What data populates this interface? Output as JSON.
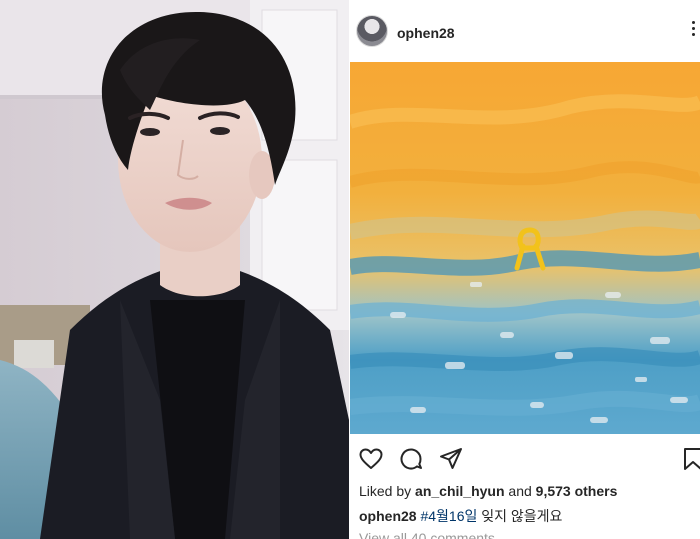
{
  "post": {
    "username": "ophen28",
    "likes_prefix": "Liked by",
    "liked_by_user": "an_chil_hyun",
    "likes_middle": "and",
    "likes_count": "9,573 others",
    "caption_user": "ophen28",
    "caption_hashtag": "#4월16일",
    "caption_text": "잊지 않을게요",
    "view_comments": "View all 40 comments"
  },
  "icons": {
    "like": "heart-icon",
    "comment": "comment-icon",
    "share": "paper-plane-icon",
    "save": "bookmark-icon",
    "more": "more-options-icon"
  },
  "colors": {
    "username": "#262626",
    "hashtag": "#003569",
    "muted": "#999999",
    "ribbon": "#f2c21b",
    "sky": "#f2a52e",
    "sea": "#4a9cc4"
  }
}
